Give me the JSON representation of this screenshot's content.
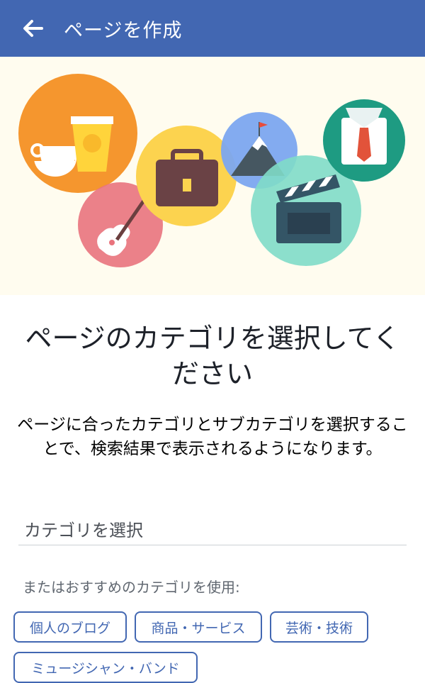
{
  "header": {
    "title": "ページを作成",
    "back_icon": "back-arrow-icon",
    "bg_color": "#4267b2"
  },
  "hero": {
    "icons": [
      "coffee-cups-icon",
      "briefcase-icon",
      "mountain-flag-icon",
      "shirt-tie-icon",
      "guitar-icon",
      "clapperboard-icon"
    ]
  },
  "main": {
    "heading": "ページのカテゴリを選択してください",
    "subtext": "ページに合ったカテゴリとサブカテゴリを選択することで、検索結果で表示されるようになります。",
    "category_placeholder": "カテゴリを選択",
    "suggest_label": "またはおすすめのカテゴリを使用:",
    "suggested_categories": [
      "個人のブログ",
      "商品・サービス",
      "芸術・技術",
      "ミュージシャン・バンド"
    ]
  },
  "colors": {
    "accent": "#4267b2",
    "hero_bg": "#fffcef"
  }
}
